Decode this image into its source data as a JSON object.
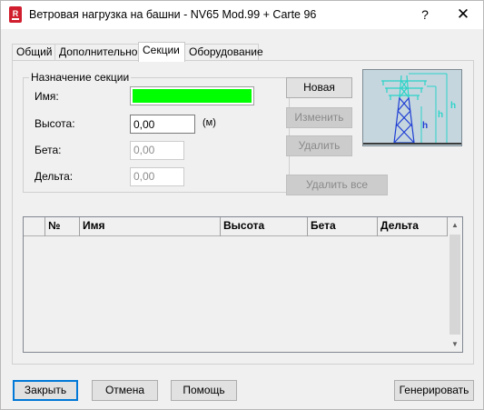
{
  "window": {
    "title": "Ветровая нагрузка на башни - NV65 Mod.99 + Carte 96",
    "help_label": "?",
    "close_label": "✕"
  },
  "icons": {
    "app": "revit-app-icon",
    "help": "help-icon",
    "close": "close-icon",
    "scroll_up": "chevron-up-icon",
    "scroll_down": "chevron-down-icon"
  },
  "tabs": [
    {
      "label": "Общий"
    },
    {
      "label": "Дополнительно"
    },
    {
      "label": "Секции",
      "active": true
    },
    {
      "label": "Оборудование"
    }
  ],
  "section": {
    "group_title": "Назначение секции",
    "name_label": "Имя:",
    "name_color": "#00ff00",
    "height_label": "Высота:",
    "height_value": "0,00",
    "height_unit": "(м)",
    "beta_label": "Бета:",
    "beta_value": "0,00",
    "delta_label": "Дельта:",
    "delta_value": "0,00"
  },
  "actions": {
    "new_label": "Новая",
    "edit_label": "Изменить",
    "delete_label": "Удалить",
    "delete_all_label": "Удалить все"
  },
  "diagram": {
    "h_label": "h"
  },
  "table": {
    "columns": [
      "№",
      "Имя",
      "Высота",
      "Бета",
      "Дельта"
    ],
    "rows": []
  },
  "footer": {
    "close_label": "Закрыть",
    "cancel_label": "Отмена",
    "help_label": "Помощь",
    "generate_label": "Генерировать"
  },
  "colors": {
    "accent": "#0078d7",
    "tower": "#1f3fd4",
    "tower_highlight": "#2ad4c8",
    "diagram_bg": "#c5d6df"
  }
}
